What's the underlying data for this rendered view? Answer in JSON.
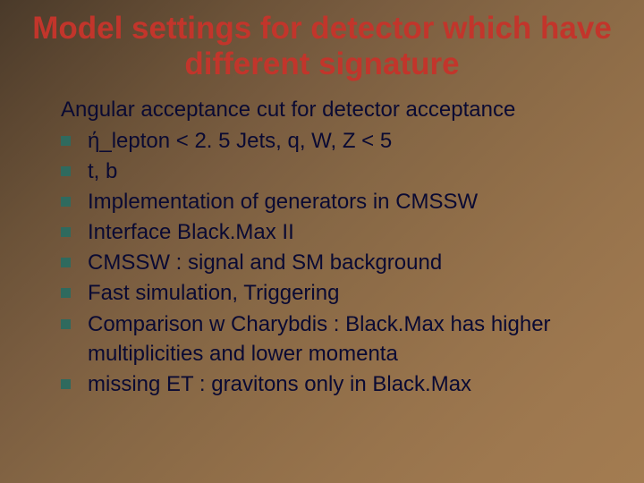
{
  "title_line1": "Model settings for detector which have",
  "title_line2": "different signature",
  "subline": "Angular acceptance cut for detector acceptance",
  "bullets": [
    "ή_lepton < 2. 5    Jets, q, W, Z < 5",
    "t, b",
    "Implementation of generators in CMSSW",
    "Interface Black.Max II",
    "CMSSW : signal and SM background",
    "Fast simulation, Triggering",
    "Comparison w Charybdis : Black.Max has higher multiplicities and lower momenta",
    "missing ET : gravitons only in Black.Max"
  ]
}
